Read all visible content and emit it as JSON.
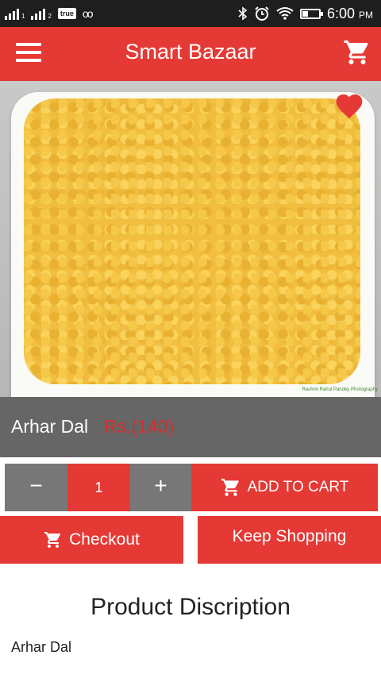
{
  "status_bar": {
    "carrier": "true",
    "voicemail": "oo",
    "sim1_label": "1",
    "sim2_label": "2",
    "time": "6:00",
    "ampm": "PM"
  },
  "app_bar": {
    "title": "Smart Bazaar",
    "menu_icon": "hamburger-menu-icon",
    "cart_icon": "shopping-cart-icon"
  },
  "product": {
    "name": "Arhar Dal",
    "price": "Rs.(140)",
    "favorite_icon": "heart-icon",
    "image_watermark": "Rashmi Rahul Pandey Photography"
  },
  "quantity": {
    "minus_label": "−",
    "value": "1",
    "plus_label": "+"
  },
  "actions": {
    "add_to_cart": "ADD TO CART",
    "checkout": "Checkout",
    "keep_shopping": "Keep Shopping"
  },
  "description": {
    "heading": "Product Discription",
    "text": "Arhar Dal"
  },
  "colors": {
    "primary": "#e53935",
    "band": "#666666",
    "qty_grey": "#777777",
    "price": "#d32f2f"
  }
}
